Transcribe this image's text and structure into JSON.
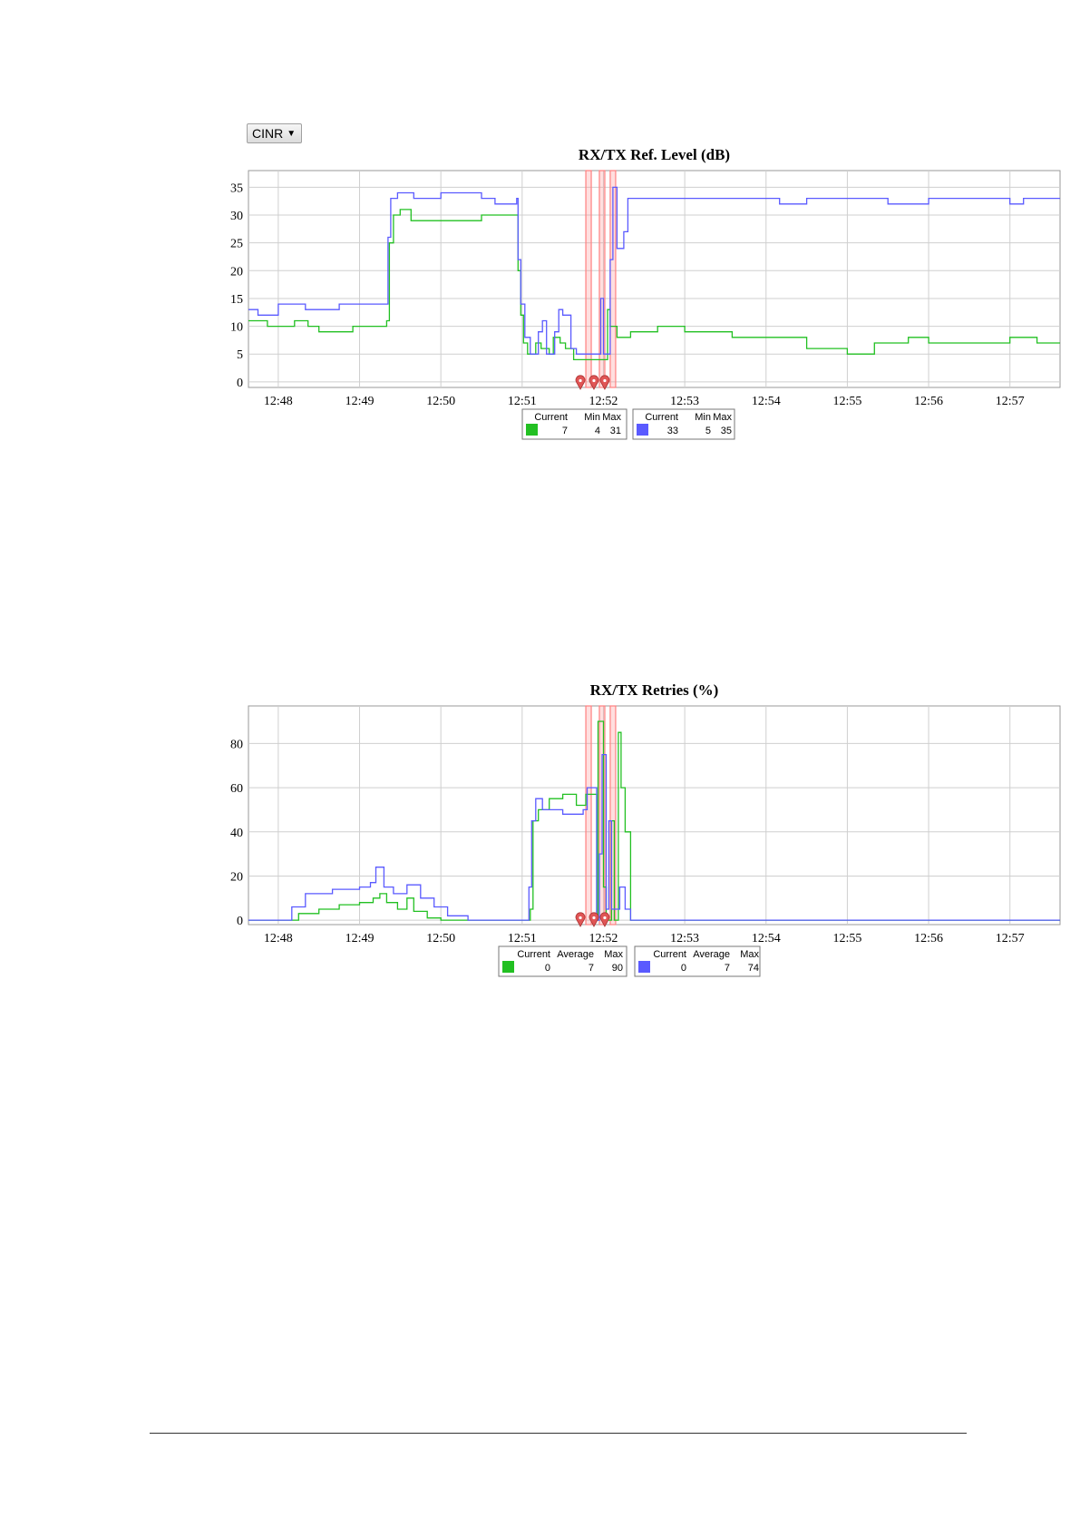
{
  "dropdown": {
    "value": "CINR",
    "arrow": "▼"
  },
  "colors": {
    "rx": "#22c022",
    "tx": "#5a5aff",
    "event_band": "#ff8080",
    "marker": "#e05555"
  },
  "chart_data": [
    {
      "type": "line",
      "title": "RX/TX Ref. Level (dB)",
      "xlabel": "",
      "ylabel": "",
      "x_ticks": [
        "12:48",
        "12:49",
        "12:50",
        "12:51",
        "12:52",
        "12:53",
        "12:54",
        "12:55",
        "12:56",
        "12:57"
      ],
      "xlim": [
        "12:47:38",
        "12:57:37"
      ],
      "ylim": [
        -1,
        38
      ],
      "y_ticks": [
        0,
        5,
        10,
        15,
        20,
        25,
        30,
        35
      ],
      "grid": true,
      "events": [
        "12:51:49",
        "12:51:59",
        "12:52:07"
      ],
      "series": [
        {
          "color": "#22c022",
          "points": [
            [
              "12:47:38",
              11
            ],
            [
              "12:47:52",
              10
            ],
            [
              "12:48:12",
              11
            ],
            [
              "12:48:22",
              10
            ],
            [
              "12:48:30",
              9
            ],
            [
              "12:48:55",
              10
            ],
            [
              "12:49:20",
              11
            ],
            [
              "12:49:22",
              25
            ],
            [
              "12:49:25",
              30
            ],
            [
              "12:49:30",
              31
            ],
            [
              "12:49:38",
              29
            ],
            [
              "12:50:30",
              30
            ],
            [
              "12:50:56",
              30
            ],
            [
              "12:50:57",
              20
            ],
            [
              "12:50:59",
              12
            ],
            [
              "12:51:01",
              7
            ],
            [
              "12:51:04",
              5
            ],
            [
              "12:51:10",
              7
            ],
            [
              "12:51:14",
              6
            ],
            [
              "12:51:20",
              5
            ],
            [
              "12:51:23",
              8
            ],
            [
              "12:51:28",
              7
            ],
            [
              "12:51:32",
              6
            ],
            [
              "12:51:38",
              4
            ],
            [
              "12:52:02",
              4
            ],
            [
              "12:52:03",
              13
            ],
            [
              "12:52:05",
              10
            ],
            [
              "12:52:10",
              8
            ],
            [
              "12:52:20",
              9
            ],
            [
              "12:52:40",
              10
            ],
            [
              "12:53:00",
              9
            ],
            [
              "12:53:35",
              8
            ],
            [
              "12:54:10",
              8
            ],
            [
              "12:54:30",
              6
            ],
            [
              "12:55:00",
              5
            ],
            [
              "12:55:20",
              7
            ],
            [
              "12:55:45",
              8
            ],
            [
              "12:56:00",
              7
            ],
            [
              "12:56:30",
              7
            ],
            [
              "12:57:00",
              8
            ],
            [
              "12:57:20",
              7
            ],
            [
              "12:57:37",
              7
            ]
          ]
        },
        {
          "color": "#5a5aff",
          "points": [
            [
              "12:47:38",
              13
            ],
            [
              "12:47:45",
              12
            ],
            [
              "12:48:00",
              14
            ],
            [
              "12:48:20",
              13
            ],
            [
              "12:48:45",
              14
            ],
            [
              "12:49:20",
              14
            ],
            [
              "12:49:21",
              26
            ],
            [
              "12:49:23",
              33
            ],
            [
              "12:49:28",
              34
            ],
            [
              "12:49:40",
              33
            ],
            [
              "12:50:00",
              34
            ],
            [
              "12:50:30",
              33
            ],
            [
              "12:50:40",
              32
            ],
            [
              "12:50:56",
              33
            ],
            [
              "12:50:57",
              22
            ],
            [
              "12:50:59",
              14
            ],
            [
              "12:51:02",
              8
            ],
            [
              "12:51:06",
              5
            ],
            [
              "12:51:12",
              9
            ],
            [
              "12:51:15",
              11
            ],
            [
              "12:51:18",
              5
            ],
            [
              "12:51:24",
              9
            ],
            [
              "12:51:27",
              13
            ],
            [
              "12:51:30",
              12
            ],
            [
              "12:51:36",
              6
            ],
            [
              "12:51:40",
              5
            ],
            [
              "12:51:58",
              15
            ],
            [
              "12:52:00",
              5
            ],
            [
              "12:52:04",
              5
            ],
            [
              "12:52:05",
              22
            ],
            [
              "12:52:07",
              35
            ],
            [
              "12:52:10",
              24
            ],
            [
              "12:52:15",
              27
            ],
            [
              "12:52:18",
              33
            ],
            [
              "12:53:00",
              33
            ],
            [
              "12:53:30",
              33
            ],
            [
              "12:54:00",
              33
            ],
            [
              "12:54:10",
              32
            ],
            [
              "12:54:30",
              33
            ],
            [
              "12:55:00",
              33
            ],
            [
              "12:55:30",
              32
            ],
            [
              "12:56:00",
              33
            ],
            [
              "12:56:30",
              33
            ],
            [
              "12:57:00",
              32
            ],
            [
              "12:57:10",
              33
            ],
            [
              "12:57:37",
              33
            ]
          ]
        }
      ],
      "legend": [
        {
          "headers": [
            "Current",
            "Min",
            "Max"
          ],
          "values": [
            "7",
            "4",
            "31"
          ],
          "color": "#22c022"
        },
        {
          "headers": [
            "Current",
            "Min",
            "Max"
          ],
          "values": [
            "33",
            "5",
            "35"
          ],
          "color": "#5a5aff"
        }
      ]
    },
    {
      "type": "line",
      "title": "RX/TX Retries (%)",
      "xlabel": "",
      "ylabel": "",
      "x_ticks": [
        "12:48",
        "12:49",
        "12:50",
        "12:51",
        "12:52",
        "12:53",
        "12:54",
        "12:55",
        "12:56",
        "12:57"
      ],
      "xlim": [
        "12:47:38",
        "12:57:37"
      ],
      "ylim": [
        -2,
        97
      ],
      "y_ticks": [
        0,
        20,
        40,
        60,
        80
      ],
      "grid": true,
      "events": [
        "12:51:49",
        "12:51:59",
        "12:52:07"
      ],
      "series": [
        {
          "color": "#22c022",
          "points": [
            [
              "12:47:38",
              0
            ],
            [
              "12:48:10",
              0
            ],
            [
              "12:48:15",
              3
            ],
            [
              "12:48:30",
              5
            ],
            [
              "12:48:45",
              7
            ],
            [
              "12:49:00",
              8
            ],
            [
              "12:49:10",
              10
            ],
            [
              "12:49:15",
              12
            ],
            [
              "12:49:20",
              8
            ],
            [
              "12:49:28",
              5
            ],
            [
              "12:49:35",
              10
            ],
            [
              "12:49:40",
              4
            ],
            [
              "12:49:50",
              1
            ],
            [
              "12:50:00",
              0
            ],
            [
              "12:51:05",
              0
            ],
            [
              "12:51:06",
              5
            ],
            [
              "12:51:08",
              45
            ],
            [
              "12:51:12",
              50
            ],
            [
              "12:51:20",
              55
            ],
            [
              "12:51:30",
              57
            ],
            [
              "12:51:40",
              52
            ],
            [
              "12:51:47",
              57
            ],
            [
              "12:51:55",
              0
            ],
            [
              "12:51:56",
              90
            ],
            [
              "12:52:00",
              15
            ],
            [
              "12:52:02",
              0
            ],
            [
              "12:52:06",
              45
            ],
            [
              "12:52:08",
              0
            ],
            [
              "12:52:11",
              85
            ],
            [
              "12:52:13",
              60
            ],
            [
              "12:52:16",
              40
            ],
            [
              "12:52:20",
              0
            ],
            [
              "12:57:37",
              0
            ]
          ]
        },
        {
          "color": "#5a5aff",
          "points": [
            [
              "12:47:38",
              0
            ],
            [
              "12:48:05",
              0
            ],
            [
              "12:48:10",
              6
            ],
            [
              "12:48:20",
              12
            ],
            [
              "12:48:40",
              14
            ],
            [
              "12:49:00",
              15
            ],
            [
              "12:49:08",
              17
            ],
            [
              "12:49:12",
              24
            ],
            [
              "12:49:18",
              15
            ],
            [
              "12:49:25",
              12
            ],
            [
              "12:49:35",
              16
            ],
            [
              "12:49:45",
              10
            ],
            [
              "12:49:55",
              6
            ],
            [
              "12:50:05",
              2
            ],
            [
              "12:50:20",
              0
            ],
            [
              "12:51:04",
              0
            ],
            [
              "12:51:05",
              15
            ],
            [
              "12:51:07",
              45
            ],
            [
              "12:51:10",
              55
            ],
            [
              "12:51:15",
              50
            ],
            [
              "12:51:30",
              48
            ],
            [
              "12:51:45",
              50
            ],
            [
              "12:51:48",
              60
            ],
            [
              "12:51:55",
              0
            ],
            [
              "12:51:57",
              30
            ],
            [
              "12:51:59",
              75
            ],
            [
              "12:52:02",
              5
            ],
            [
              "12:52:04",
              45
            ],
            [
              "12:52:06",
              5
            ],
            [
              "12:52:12",
              15
            ],
            [
              "12:52:16",
              5
            ],
            [
              "12:52:20",
              0
            ],
            [
              "12:57:37",
              0
            ]
          ]
        }
      ],
      "legend": [
        {
          "headers": [
            "Current",
            "Average",
            "Max"
          ],
          "values": [
            "0",
            "7",
            "90"
          ],
          "color": "#22c022"
        },
        {
          "headers": [
            "Current",
            "Average",
            "Max"
          ],
          "values": [
            "0",
            "7",
            "74"
          ],
          "color": "#5a5aff"
        }
      ]
    }
  ]
}
